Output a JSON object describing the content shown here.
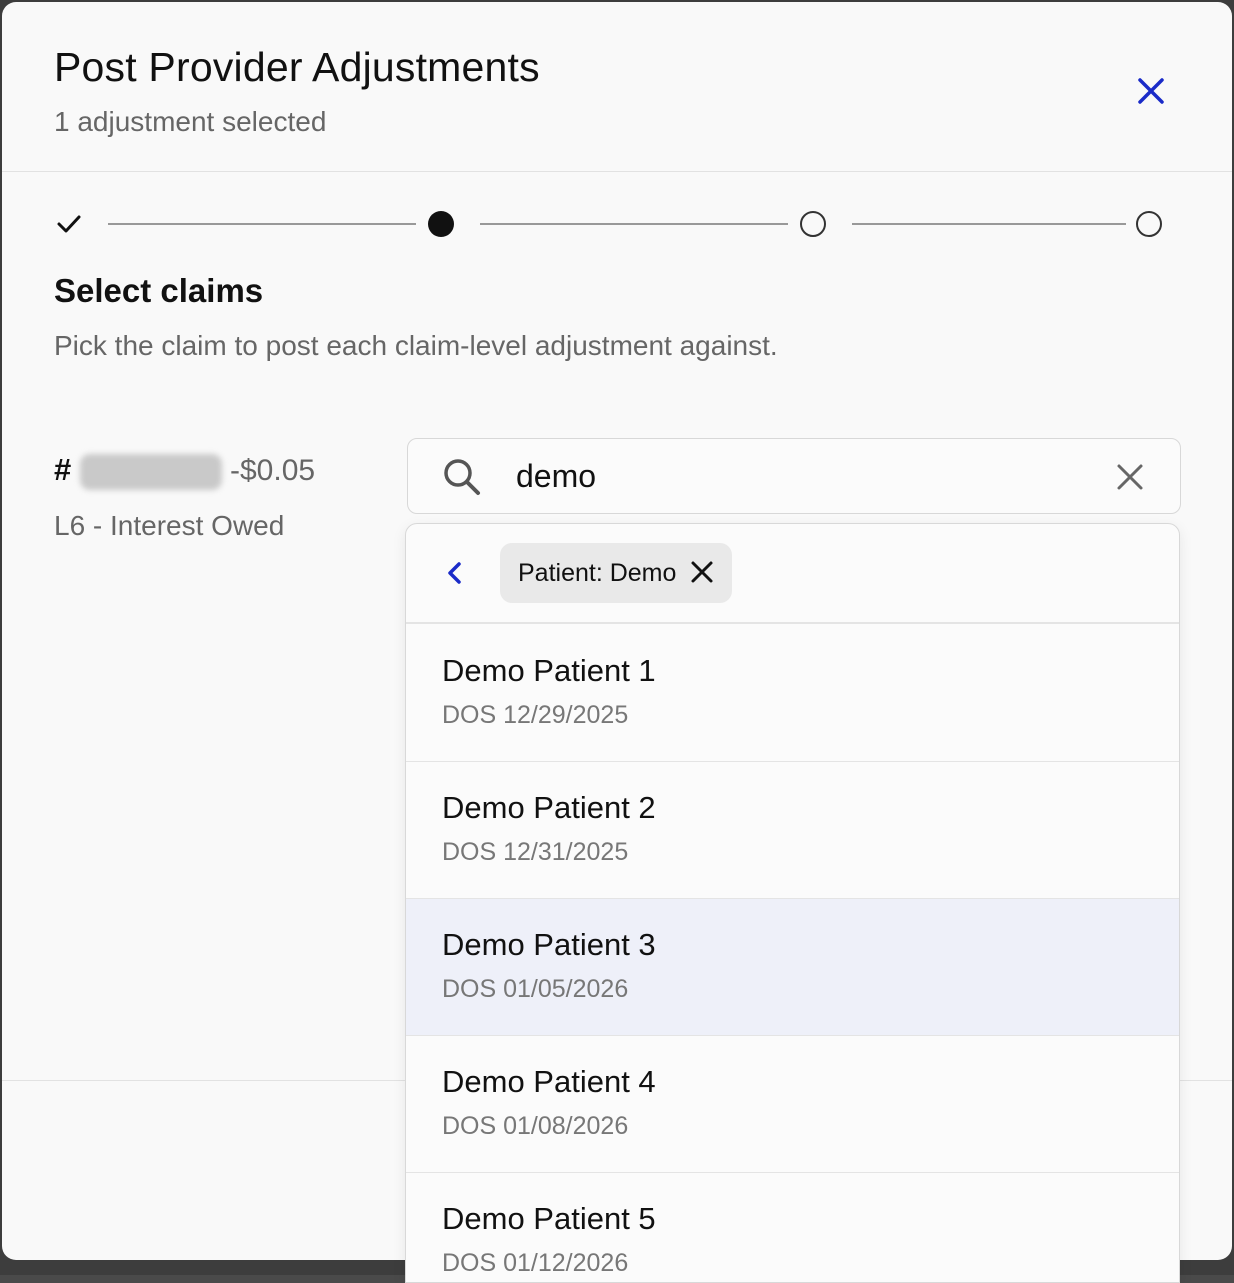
{
  "modal": {
    "title": "Post Provider Adjustments",
    "subtitle": "1 adjustment selected"
  },
  "stepper": {
    "steps": [
      {
        "state": "complete"
      },
      {
        "state": "active"
      },
      {
        "state": "pending"
      },
      {
        "state": "pending"
      }
    ]
  },
  "section": {
    "title": "Select claims",
    "description": "Pick the claim to post each claim-level adjustment against."
  },
  "claim": {
    "hash": "#",
    "amount": "-$0.05",
    "code": "L6 - Interest Owed"
  },
  "search": {
    "value": "demo"
  },
  "filter": {
    "chip_label": "Patient: Demo"
  },
  "results": [
    {
      "name": "Demo Patient 1",
      "dos": "DOS 12/29/2025"
    },
    {
      "name": "Demo Patient 2",
      "dos": "DOS 12/31/2025"
    },
    {
      "name": "Demo Patient 3",
      "dos": "DOS 01/05/2026",
      "highlighted": true
    },
    {
      "name": "Demo Patient 4",
      "dos": "DOS 01/08/2026"
    },
    {
      "name": "Demo Patient 5",
      "dos": "DOS 01/12/2026"
    }
  ],
  "colors": {
    "accent": "#1a2bc8",
    "highlight_row": "#eef0f9"
  }
}
